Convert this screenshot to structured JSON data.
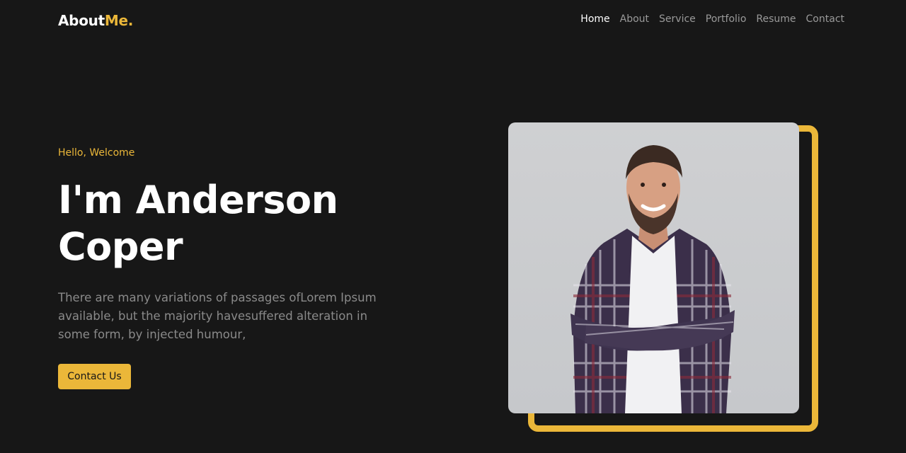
{
  "brand": {
    "name": "About",
    "accent": "Me."
  },
  "nav": {
    "items": [
      "Home",
      "About",
      "Service",
      "Portfolio",
      "Resume",
      "Contact"
    ],
    "active": "Home"
  },
  "hero": {
    "eyebrow": "Hello, Welcome",
    "title_line1": "I'm Anderson",
    "title_line2": "Coper",
    "description": "There are many variations of passages ofLorem Ipsum available, but the majority havesuffered alteration in some form, by injected humour,",
    "cta_label": "Contact Us"
  },
  "colors": {
    "background": "#171717",
    "accent": "#ebb739",
    "muted_text": "#8a8a8a",
    "nav_text": "#9a9a9a"
  }
}
